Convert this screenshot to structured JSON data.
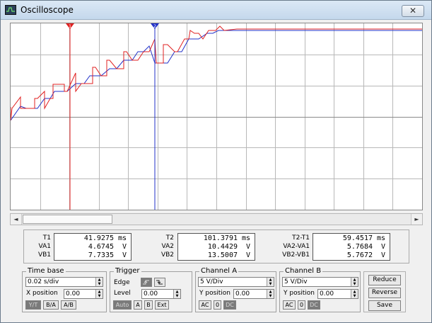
{
  "window": {
    "title": "Oscilloscope",
    "close_glyph": "✕"
  },
  "cursors": [
    {
      "label": "1",
      "color": "#e02020"
    },
    {
      "label": "2",
      "color": "#2030c8"
    }
  ],
  "colors": {
    "channel_a": "#e02020",
    "channel_b": "#2030c8",
    "grid": "#b8b8b8"
  },
  "scrollbar": {
    "left_arrow": "◄",
    "right_arrow": "►"
  },
  "readout": {
    "t1": {
      "label": "T1",
      "value": "41.9275",
      "unit": "ms"
    },
    "va1": {
      "label": "VA1",
      "value": "4.6745",
      "unit": "V"
    },
    "vb1": {
      "label": "VB1",
      "value": "7.7335",
      "unit": "V"
    },
    "t2": {
      "label": "T2",
      "value": "101.3791",
      "unit": "ms"
    },
    "va2": {
      "label": "VA2",
      "value": "10.4429",
      "unit": "V"
    },
    "vb2": {
      "label": "VB2",
      "value": "13.5007",
      "unit": "V"
    },
    "t2t1": {
      "label": "T2-T1",
      "value": "59.4517",
      "unit": "ms"
    },
    "va2va1": {
      "label": "VA2-VA1",
      "value": "5.7684",
      "unit": "V"
    },
    "vb2vb1": {
      "label": "VB2-VB1",
      "value": "5.7672",
      "unit": "V"
    }
  },
  "timebase": {
    "title": "Time base",
    "value": "0.02 s/div",
    "xpos_label": "X position",
    "xpos_value": "0.00",
    "buttons": [
      "Y/T",
      "B/A",
      "A/B"
    ]
  },
  "trigger": {
    "title": "Trigger",
    "edge_label": "Edge",
    "level_label": "Level",
    "level_value": "0.00",
    "buttons": [
      "Auto",
      "A",
      "B",
      "Ext"
    ]
  },
  "channel_a": {
    "title": "Channel A",
    "value": "5 V/Div",
    "ypos_label": "Y position",
    "ypos_value": "0.00",
    "buttons": [
      "AC",
      "0",
      "DC"
    ]
  },
  "channel_b": {
    "title": "Channel B",
    "value": "5 V/Div",
    "ypos_label": "Y position",
    "ypos_value": "0.00",
    "buttons": [
      "AC",
      "0",
      "DC"
    ]
  },
  "side_buttons": [
    "Reduce",
    "Reverse",
    "Save"
  ],
  "icons": {
    "window": "oscilloscope-icon",
    "edge_rising": "rising-edge-icon",
    "edge_falling": "falling-edge-icon",
    "spin_up": "▲",
    "spin_down": "▼"
  }
}
